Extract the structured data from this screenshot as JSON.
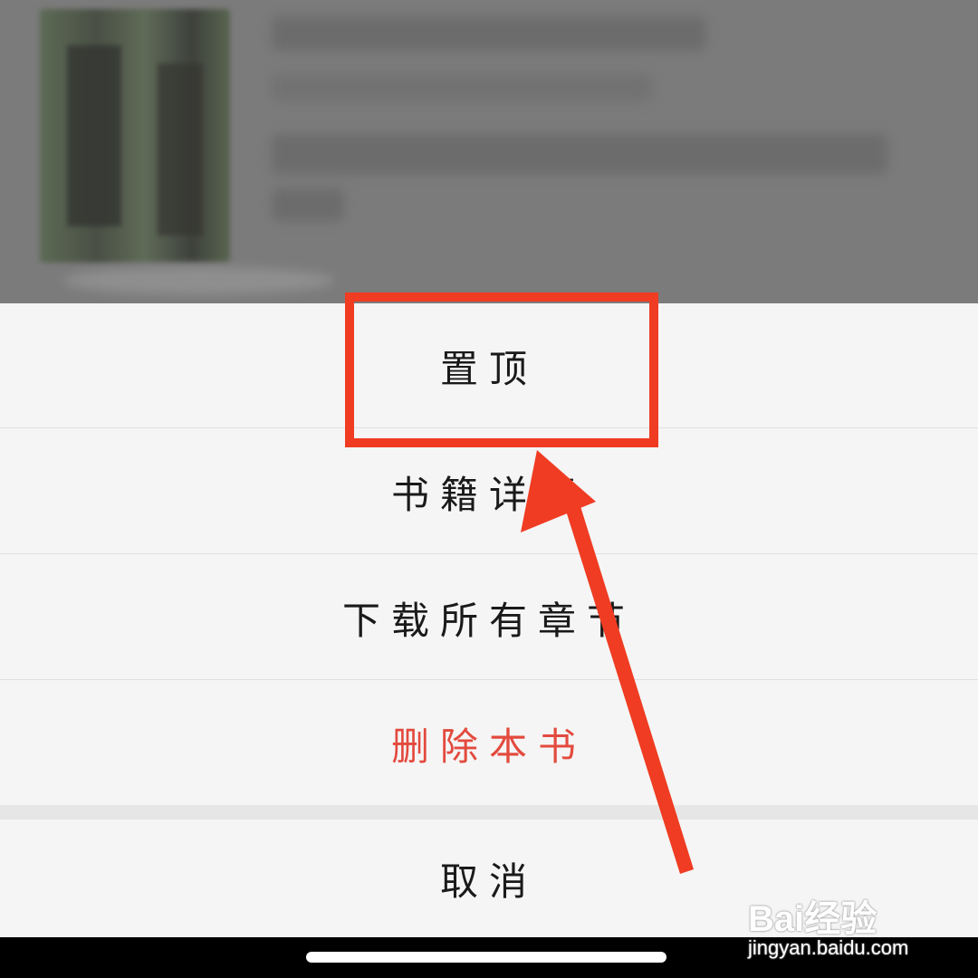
{
  "sheet": {
    "items": [
      {
        "label": "置顶"
      },
      {
        "label": "书籍详情"
      },
      {
        "label": "下载所有章节"
      },
      {
        "label": "删除本书"
      }
    ],
    "cancel_label": "取消"
  },
  "colors": {
    "danger_text": "#e34a3e",
    "annotation": "#ef3c22",
    "sheet_background": "#f5f5f5"
  },
  "watermark": {
    "brand": "Bai经验",
    "url": "jingyan.baidu.com"
  }
}
